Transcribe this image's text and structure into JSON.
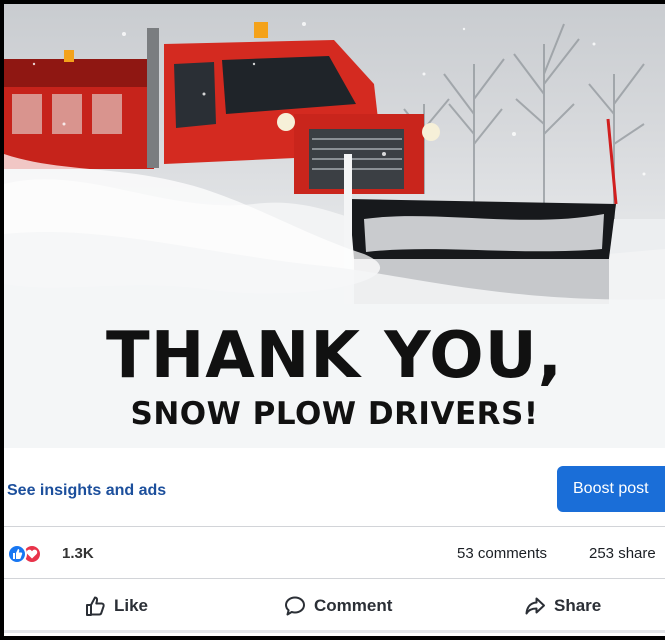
{
  "post": {
    "headline": "THANK YOU,",
    "subheadline": "SNOW PLOW DRIVERS!"
  },
  "insights": {
    "link_label": "See insights and ads",
    "boost_label": "Boost post"
  },
  "stats": {
    "reaction_icons": [
      "like-icon",
      "love-icon"
    ],
    "reaction_count": "1.3K",
    "comments": "53 comments",
    "shares": "253 share"
  },
  "actions": [
    {
      "label": "Like",
      "icon": "thumbs-up-icon"
    },
    {
      "label": "Comment",
      "icon": "comment-bubble-icon"
    },
    {
      "label": "Share",
      "icon": "share-arrow-icon"
    }
  ],
  "colors": {
    "brand_blue": "#1a6ed8",
    "link_blue": "#1c4f9c",
    "like_blue": "#1877f2",
    "love_red": "#e8334a",
    "truck_red": "#d42a20"
  }
}
